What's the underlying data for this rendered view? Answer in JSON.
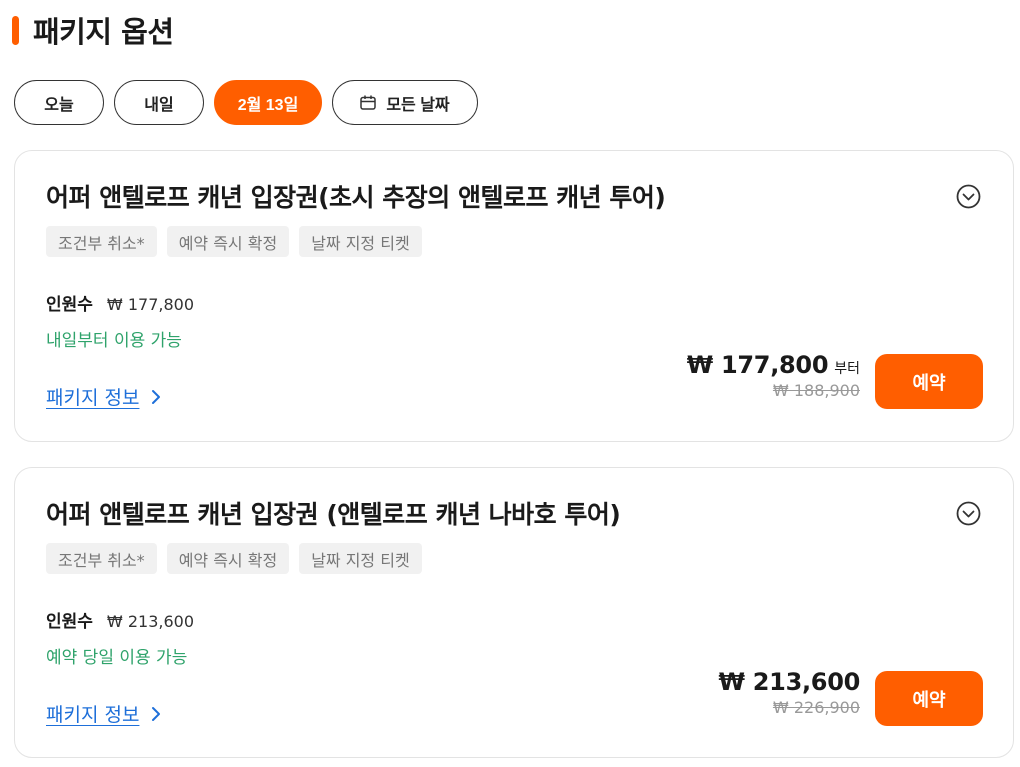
{
  "header": {
    "title": "패키지 옵션"
  },
  "date_filter": {
    "today_label": "오늘",
    "tomorrow_label": "내일",
    "selected_label": "2월 13일",
    "all_dates_label": "모든 날짜"
  },
  "colors": {
    "accent": "#ff5e00",
    "availability": "#2fa36b",
    "link": "#1e6fd9"
  },
  "packages": [
    {
      "title": "어퍼 앤텔로프 캐년 입장권(초시 추장의 앤텔로프 캐년 투어)",
      "tags": [
        "조건부 취소*",
        "예약 즉시 확정",
        "날짜 지정 티켓"
      ],
      "pax_label": "인원수",
      "pax_price": "₩ 177,800",
      "availability": "내일부터 이용 가능",
      "info_link": "패키지 정보",
      "price": "₩ 177,800",
      "price_suffix": "부터",
      "original_price": "₩ 188,900",
      "book_label": "예약"
    },
    {
      "title": "어퍼 앤텔로프 캐년 입장권 (앤텔로프 캐년 나바호 투어)",
      "tags": [
        "조건부 취소*",
        "예약 즉시 확정",
        "날짜 지정 티켓"
      ],
      "pax_label": "인원수",
      "pax_price": "₩ 213,600",
      "availability": "예약 당일 이용 가능",
      "info_link": "패키지 정보",
      "price": "₩ 213,600",
      "original_price": "₩ 226,900",
      "book_label": "예약"
    }
  ]
}
